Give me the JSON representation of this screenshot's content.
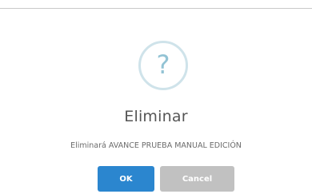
{
  "dialog": {
    "icon": "question-mark-icon",
    "icon_glyph": "?",
    "title": "Eliminar",
    "message": "Eliminará AVANCE PRUEBA MANUAL EDICIÓN",
    "ok_label": "OK",
    "cancel_label": "Cancel"
  },
  "colors": {
    "ok_button": "#2b86cf",
    "cancel_button": "#c1c1c1",
    "icon_ring": "#cfe3ea",
    "icon_glyph": "#92c3d4"
  }
}
